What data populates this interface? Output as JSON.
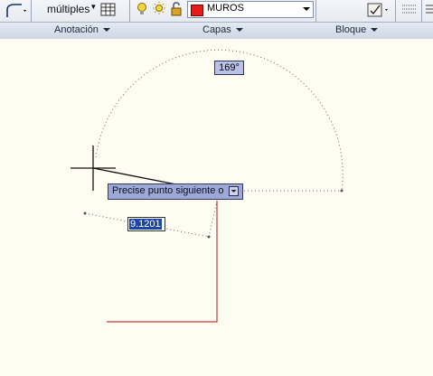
{
  "ribbon": {
    "multiline_label": "múltiples",
    "layer_name": "MUROS",
    "layer_color": "#e31b1b",
    "panels": [
      "Anotación",
      "Capas",
      "Bloque"
    ]
  },
  "drawing": {
    "prompt_text": "Precise punto siguiente o",
    "angle_value": "169°",
    "distance_value": "9.1201",
    "polyline_color": "#c23a3a",
    "background": "#fffcf1"
  }
}
